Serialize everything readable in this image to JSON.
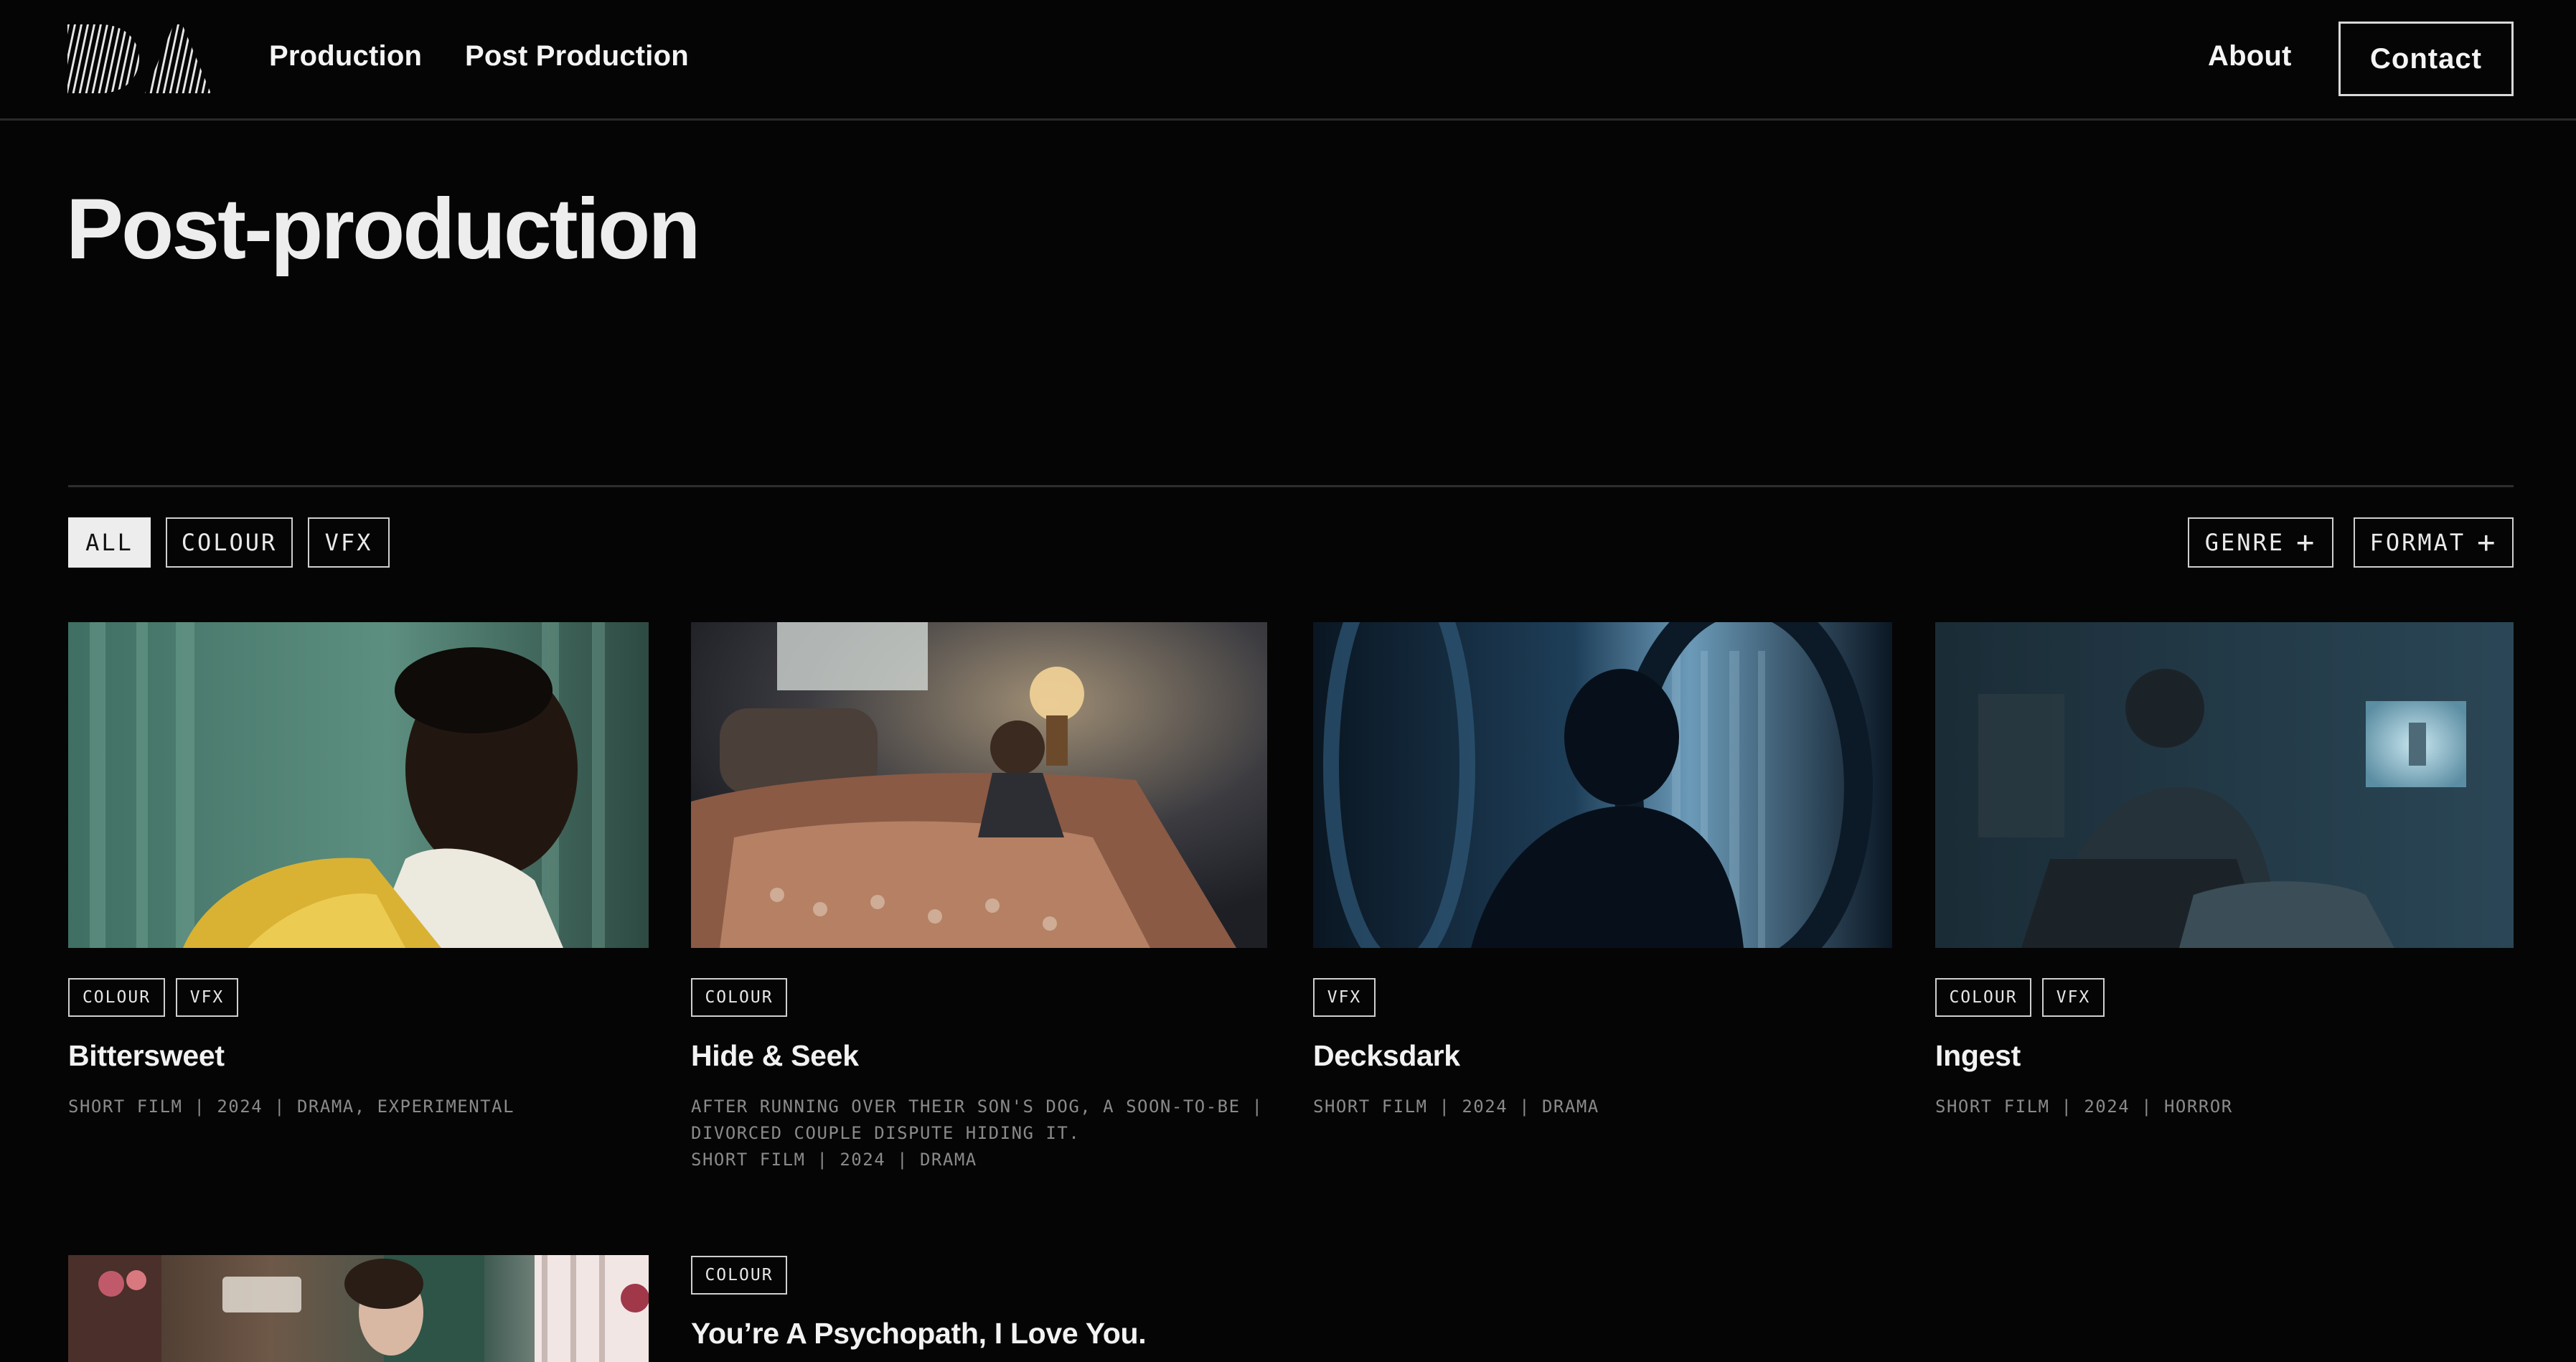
{
  "header": {
    "logo_text": "DA",
    "nav": [
      "Production",
      "Post Production"
    ],
    "about": "About",
    "contact": "Contact"
  },
  "page": {
    "title": "Post-production"
  },
  "filters": {
    "categories": [
      "ALL",
      "COLOUR",
      "VFX"
    ],
    "active": "ALL",
    "genre": "GENRE",
    "format": "FORMAT"
  },
  "projects": [
    {
      "title": "Bittersweet",
      "tags": [
        "COLOUR",
        "VFX"
      ],
      "meta": [
        "SHORT FILM | 2024 | DRAMA, EXPERIMENTAL"
      ]
    },
    {
      "title": "Hide & Seek",
      "tags": [
        "COLOUR"
      ],
      "meta": [
        "AFTER RUNNING OVER THEIR SON'S DOG, A SOON-TO-BE  |",
        "DIVORCED COUPLE DISPUTE HIDING IT.",
        "SHORT FILM | 2024 | DRAMA"
      ]
    },
    {
      "title": "Decksdark",
      "tags": [
        "VFX"
      ],
      "meta": [
        "SHORT FILM | 2024 | DRAMA"
      ]
    },
    {
      "title": "Ingest",
      "tags": [
        "COLOUR",
        "VFX"
      ],
      "meta": [
        "SHORT FILM | 2024 | HORROR"
      ]
    },
    {
      "title": "",
      "tags": [],
      "meta": []
    },
    {
      "title": "You’re A Psychopath, I Love You.",
      "tags": [
        "COLOUR"
      ],
      "meta": []
    }
  ],
  "colors": {
    "background": "#050505",
    "text": "#f2f2f2",
    "muted": "#8a8a8a",
    "border": "#cfcfcf"
  }
}
